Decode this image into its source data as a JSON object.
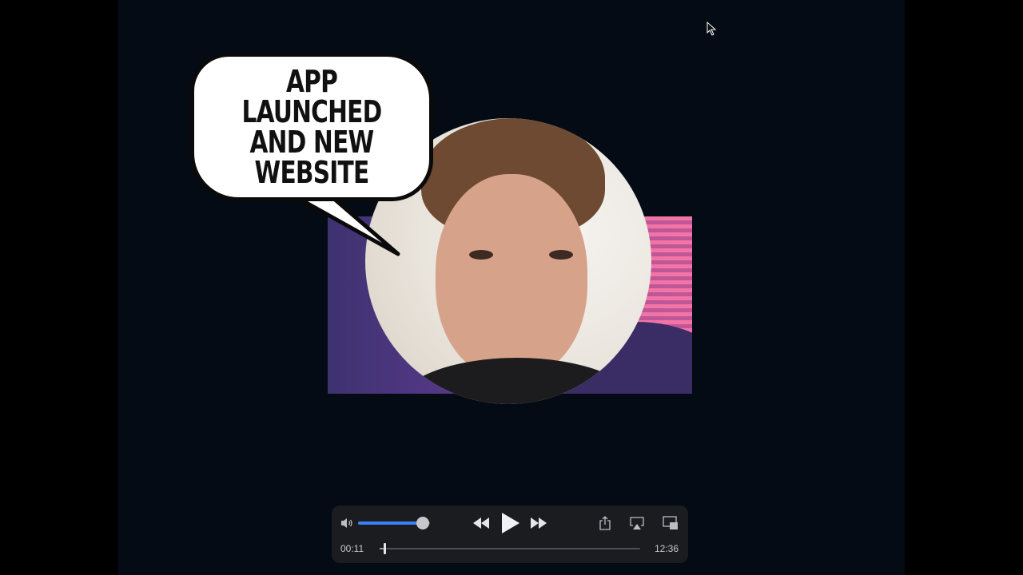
{
  "overlay": {
    "bubble_text": "APP LAUNCHED\nAND NEW\nWEBSITE"
  },
  "player": {
    "current_time": "00:11",
    "total_time": "12:36",
    "progress_fraction": 0.015,
    "volume_fraction": 0.9,
    "icons": {
      "volume": "speaker-volume-icon",
      "rewind": "rewind-icon",
      "play": "play-icon",
      "forward": "fast-forward-icon",
      "share": "share-icon",
      "airplay": "airplay-icon",
      "pip": "picture-in-picture-icon"
    }
  },
  "colors": {
    "accent": "#3b82f6",
    "background": "#040b14"
  }
}
